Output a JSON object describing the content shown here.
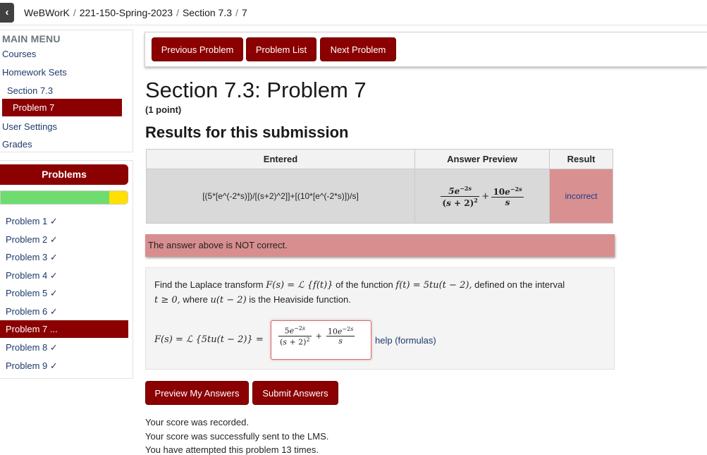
{
  "breadcrumb": {
    "back_icon": "close-icon",
    "items": [
      "WeBWorK",
      "221-150-Spring-2023",
      "Section 7.3",
      "7"
    ]
  },
  "menu": {
    "heading": "MAIN MENU",
    "courses": "Courses",
    "homework_sets": "Homework Sets",
    "section": "Section 7.3",
    "problem": "Problem 7",
    "user_settings": "User Settings",
    "grades": "Grades"
  },
  "problems_panel": {
    "heading": "Problems",
    "progress_correct_fraction": 0.857,
    "progress_incorrect_fraction": 0.143,
    "items": [
      "Problem 1 ✓",
      "Problem 2 ✓",
      "Problem 3 ✓",
      "Problem 4 ✓",
      "Problem 5 ✓",
      "Problem 6 ✓",
      "Problem 7 ...",
      "Problem 8 ✓",
      "Problem 9 ✓"
    ],
    "active_index": 6
  },
  "nav": {
    "previous": "Previous Problem",
    "list": "Problem List",
    "next": "Next Problem"
  },
  "title": "Section 7.3: Problem 7",
  "points": "(1 point)",
  "results_title": "Results for this submission",
  "results_table": {
    "headers": [
      "Entered",
      "Answer Preview",
      "Result"
    ],
    "entered": "[(5*[e^(-2*s)])/[(s+2)^2]]+[(10*[e^(-2*s)])/s]",
    "result": "incorrect"
  },
  "notice": "The answer above is NOT correct.",
  "problem": {
    "line1_a": "Find the Laplace transform",
    "line1_math1": "F(s) = ℒ {f(t)}",
    "line1_b": "of the function",
    "line1_math2": "f(t) = 5tu(t − 2),",
    "line1_c": "defined on the interval",
    "line2_math1": "t ≥ 0,",
    "line2_a": "where",
    "line2_math2": "u(t − 2)",
    "line2_b": "is the Heaviside function.",
    "answer_label": "F(s) = ℒ {5tu(t − 2)} =",
    "help": "help (formulas)"
  },
  "buttons": {
    "preview": "Preview My Answers",
    "submit": "Submit Answers"
  },
  "footer": {
    "line1": "Your score was recorded.",
    "line2": "Your score was successfully sent to the LMS.",
    "line3": "You have attempted this problem 13 times."
  },
  "colors": {
    "brand": "#8b0000",
    "incorrect_bg": "#d99090",
    "progress_green": "#6fdc6f",
    "progress_yellow": "#ffe000"
  }
}
